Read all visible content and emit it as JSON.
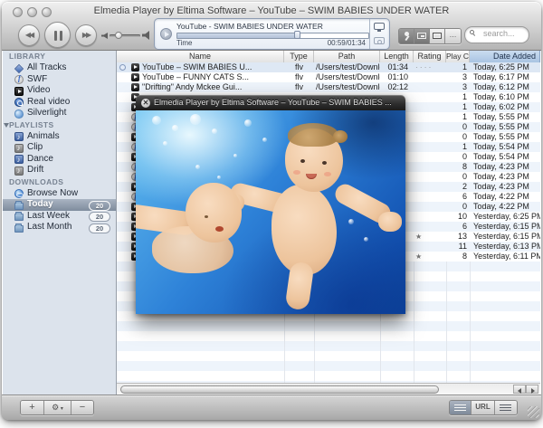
{
  "window": {
    "title": "Elmedia Player by Eltima Software – YouTube – SWIM BABIES UNDER WATER"
  },
  "toolbar": {
    "transport": {
      "rewind_icon": "rewind-icon",
      "pause_icon": "pause-icon",
      "forward_icon": "fast-forward-icon"
    },
    "volume": {
      "level_pct": 22
    },
    "lcd": {
      "track_title": "YouTube - SWIM BABIES UNDER WATER",
      "time_label": "Time",
      "time_value": "00:59/01:34",
      "progress_pct": 63,
      "icons": [
        "display-icon",
        "camera-icon"
      ]
    },
    "buttons": {
      "pin": "pin-icon",
      "pip": "picture-in-picture-icon",
      "fullscreen": "fullscreen-icon",
      "more": "..."
    },
    "search": {
      "placeholder": "search..."
    }
  },
  "sidebar": {
    "sections": [
      {
        "title": "LIBRARY",
        "collapsible": false,
        "items": [
          {
            "label": "All Tracks",
            "icon": "i-diamond"
          },
          {
            "label": "SWF",
            "icon": "i-swf"
          },
          {
            "label": "Video",
            "icon": "i-video"
          },
          {
            "label": "Real video",
            "icon": "i-real"
          },
          {
            "label": "Silverlight",
            "icon": "i-silver"
          }
        ]
      },
      {
        "title": "PLAYLISTS",
        "collapsible": true,
        "items": [
          {
            "label": "Animals",
            "icon": "i-note-blue"
          },
          {
            "label": "Clip",
            "icon": "i-note-gray"
          },
          {
            "label": "Dance",
            "icon": "i-note-blue"
          },
          {
            "label": "Drift",
            "icon": "i-note-gray"
          }
        ]
      },
      {
        "title": "DOWNLOADS",
        "collapsible": false,
        "items": [
          {
            "label": "Browse Now",
            "icon": "i-globe"
          },
          {
            "label": "Today",
            "icon": "i-folder",
            "badge": "20",
            "selected": true
          },
          {
            "label": "Last Week",
            "icon": "i-folder",
            "badge": "20"
          },
          {
            "label": "Last Month",
            "icon": "i-folder",
            "badge": "20"
          }
        ]
      }
    ]
  },
  "table": {
    "columns": [
      "Name",
      "Type",
      "Path",
      "Length",
      "Rating",
      "Play Count",
      "Date Added"
    ],
    "sorted_column": "Date Added",
    "rows": [
      {
        "icon": "video",
        "playing": true,
        "name": "YouTube – SWIM BABIES U...",
        "type": "flv",
        "path": "/Users/test/Downlo...",
        "length": "01:34",
        "rating": "· · · ·",
        "play_count": "1",
        "date_added": "Today, 6:25 PM"
      },
      {
        "icon": "video",
        "name": "YouTube – FUNNY CATS S...",
        "type": "flv",
        "path": "/Users/test/Downlo...",
        "length": "01:10",
        "rating": "",
        "play_count": "3",
        "date_added": "Today, 6:17 PM"
      },
      {
        "icon": "video",
        "name": "\"Drifting\" Andy Mckee Gui...",
        "type": "flv",
        "path": "/Users/test/Downlo...",
        "length": "02:12",
        "rating": "",
        "play_count": "3",
        "date_added": "Today, 6:12 PM"
      },
      {
        "icon": "video",
        "name": "",
        "type": "",
        "path": "",
        "length": "",
        "rating": "",
        "play_count": "1",
        "date_added": "Today, 6:10 PM"
      },
      {
        "icon": "video",
        "name": "",
        "type": "",
        "path": "",
        "length": "",
        "rating": "",
        "play_count": "1",
        "date_added": "Today, 6:02 PM"
      },
      {
        "icon": "swf",
        "name": "",
        "type": "",
        "path": "",
        "length": "",
        "rating": "",
        "play_count": "1",
        "date_added": "Today, 5:55 PM"
      },
      {
        "icon": "swf",
        "name": "",
        "type": "",
        "path": "",
        "length": "",
        "rating": "",
        "play_count": "0",
        "date_added": "Today, 5:55 PM"
      },
      {
        "icon": "video",
        "name": "",
        "type": "",
        "path": "",
        "length": "",
        "rating": "",
        "play_count": "0",
        "date_added": "Today, 5:55 PM"
      },
      {
        "icon": "swf",
        "name": "",
        "type": "",
        "path": "",
        "length": "",
        "rating": "",
        "play_count": "1",
        "date_added": "Today, 5:54 PM"
      },
      {
        "icon": "video",
        "name": "",
        "type": "",
        "path": "",
        "length": "",
        "rating": "",
        "play_count": "0",
        "date_added": "Today, 5:54 PM"
      },
      {
        "icon": "swf",
        "name": "",
        "type": "",
        "path": "",
        "length": "",
        "rating": "",
        "play_count": "8",
        "date_added": "Today, 4:23 PM"
      },
      {
        "icon": "swf",
        "name": "",
        "type": "",
        "path": "",
        "length": "",
        "rating": "",
        "play_count": "0",
        "date_added": "Today, 4:23 PM"
      },
      {
        "icon": "video",
        "name": "",
        "type": "",
        "path": "",
        "length": "",
        "rating": "",
        "play_count": "2",
        "date_added": "Today, 4:23 PM"
      },
      {
        "icon": "swf",
        "name": "",
        "type": "",
        "path": "",
        "length": "",
        "rating": "",
        "play_count": "6",
        "date_added": "Today, 4:22 PM"
      },
      {
        "icon": "video",
        "name": "",
        "type": "",
        "path": "",
        "length": "",
        "rating": "",
        "play_count": "0",
        "date_added": "Today, 4:22 PM"
      },
      {
        "icon": "video",
        "name": "",
        "type": "",
        "path": "",
        "length": "",
        "rating": "",
        "play_count": "10",
        "date_added": "Yesterday, 6:25 PM"
      },
      {
        "icon": "video",
        "name": "",
        "type": "",
        "path": "",
        "length": "",
        "rating": "",
        "play_count": "6",
        "date_added": "Yesterday, 6:15 PM"
      },
      {
        "icon": "video",
        "name": "",
        "type": "",
        "path": "",
        "length": "",
        "rating": "★",
        "play_count": "13",
        "date_added": "Yesterday, 6:15 PM"
      },
      {
        "icon": "video",
        "name": "",
        "type": "",
        "path": "",
        "length": "",
        "rating": "",
        "play_count": "11",
        "date_added": "Yesterday, 6:13 PM"
      },
      {
        "icon": "video",
        "name": "",
        "type": "",
        "path": "",
        "length": "",
        "rating": "★",
        "play_count": "8",
        "date_added": "Yesterday, 6:11 PM"
      }
    ]
  },
  "video_window": {
    "title": "Elmedia Player by Eltima Software – YouTube – SWIM BABIES ...",
    "close_label": "✕",
    "scene": "two babies swimming underwater in bright blue pool",
    "water_color": "#2e82d8"
  },
  "bottom_bar": {
    "add_label": "+",
    "action_icon": "gear-icon",
    "remove_label": "−",
    "url_label": "URL",
    "view_icons": [
      "list-view-icon",
      "playlist-view-icon"
    ]
  }
}
